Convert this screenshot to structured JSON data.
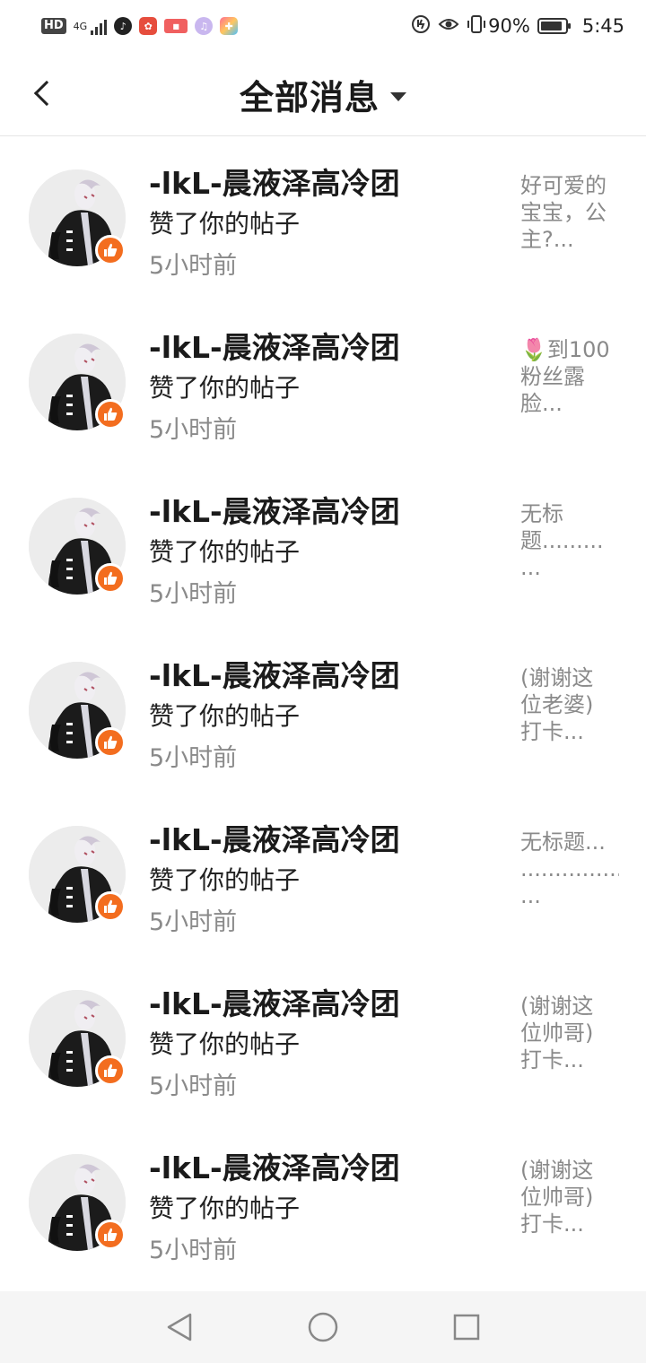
{
  "status_bar": {
    "network": "HD",
    "network_type": "4G",
    "battery_percent": "90%",
    "battery_level": 0.9,
    "time": "5:45"
  },
  "header": {
    "title": "全部消息"
  },
  "notifications": [
    {
      "name": "-lkL-晨液泽高冷团",
      "action": "赞了你的帖子",
      "time": "5小时前",
      "preview": [
        "好可爱的",
        "宝宝，公",
        "主?..."
      ]
    },
    {
      "name": "-lkL-晨液泽高冷团",
      "action": "赞了你的帖子",
      "time": "5小时前",
      "preview": [
        "🌷到100",
        "粉丝露",
        "脸..."
      ]
    },
    {
      "name": "-lkL-晨液泽高冷团",
      "action": "赞了你的帖子",
      "time": "5小时前",
      "preview": [
        "无标",
        "题.........",
        "..."
      ]
    },
    {
      "name": "-lkL-晨液泽高冷团",
      "action": "赞了你的帖子",
      "time": "5小时前",
      "preview": [
        "(谢谢这",
        "位老婆)",
        "打卡..."
      ]
    },
    {
      "name": "-lkL-晨液泽高冷团",
      "action": "赞了你的帖子",
      "time": "5小时前",
      "preview": [
        "无标题...",
        "...............",
        "..."
      ]
    },
    {
      "name": "-lkL-晨液泽高冷团",
      "action": "赞了你的帖子",
      "time": "5小时前",
      "preview": [
        "(谢谢这",
        "位帅哥)",
        "打卡..."
      ]
    },
    {
      "name": "-lkL-晨液泽高冷团",
      "action": "赞了你的帖子",
      "time": "5小时前",
      "preview": [
        "(谢谢这",
        "位帅哥)",
        "打卡..."
      ]
    }
  ],
  "colors": {
    "like_badge": "#f36d1f",
    "secondary_text": "#8a8a8a"
  }
}
